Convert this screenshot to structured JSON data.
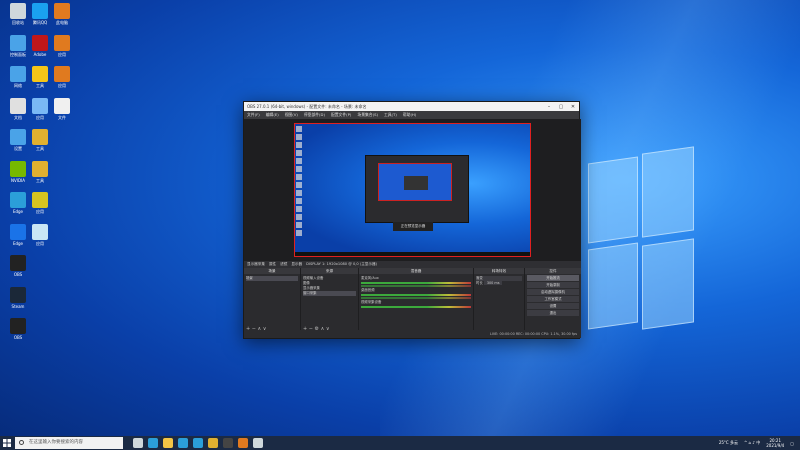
{
  "desktop_icons": [
    {
      "name": "icon-recycle",
      "label": "回收站",
      "color": "#cfd8dc"
    },
    {
      "name": "icon-qq",
      "label": "腾讯QQ",
      "color": "#1aa1f0"
    },
    {
      "name": "icon-app3",
      "label": "此电脑",
      "color": "#e07a1f"
    },
    {
      "name": "icon-app4",
      "label": "控制面板",
      "color": "#4aa3e8"
    },
    {
      "name": "icon-app5",
      "label": "Adobe",
      "color": "#c0171a"
    },
    {
      "name": "icon-app6",
      "label": "应用",
      "color": "#e07a1f"
    },
    {
      "name": "icon-app7",
      "label": "网络",
      "color": "#4aa3e8"
    },
    {
      "name": "icon-app8",
      "label": "工具",
      "color": "#f5c518"
    },
    {
      "name": "icon-app9",
      "label": "应用",
      "color": "#e07a1f"
    },
    {
      "name": "icon-app10",
      "label": "文档",
      "color": "#e0e0e0"
    },
    {
      "name": "icon-app11",
      "label": "应用",
      "color": "#7ab8f5"
    },
    {
      "name": "icon-app12",
      "label": "文件",
      "color": "#f0f0f0"
    },
    {
      "name": "icon-app13",
      "label": "设置",
      "color": "#4aa3e8"
    },
    {
      "name": "icon-app14",
      "label": "工具",
      "color": "#e0b030"
    },
    {
      "name": "icon-app15",
      "label": "NVIDIA",
      "color": "#76b900"
    },
    {
      "name": "icon-app16",
      "label": "工具",
      "color": "#e0b030"
    },
    {
      "name": "icon-app17",
      "label": "Edge",
      "color": "#2b9fd9"
    },
    {
      "name": "icon-app18",
      "label": "应用",
      "color": "#d6c420"
    },
    {
      "name": "icon-app19",
      "label": "Edge",
      "color": "#1a73e8"
    },
    {
      "name": "icon-app20",
      "label": "应用",
      "color": "#c9e6f5"
    },
    {
      "name": "icon-app21",
      "label": "OBS",
      "color": "#222"
    },
    {
      "name": "icon-app22",
      "label": "Steam",
      "color": "#1b2838"
    },
    {
      "name": "icon-app23",
      "label": "OBS",
      "color": "#222"
    }
  ],
  "obs": {
    "title": "OBS 27.0.1 (64-bit, windows) - 配置文件: 未命名 - 场景: 未命名",
    "menu": [
      "文件(F)",
      "编辑(E)",
      "视图(V)",
      "停靠部件(D)",
      "配置文件(P)",
      "场景集合(S)",
      "工具(T)",
      "帮助(H)"
    ],
    "scenebar": [
      "显示器采集",
      "属性",
      "滤镜",
      "显示器",
      "DISPLAY 1: 1920x1080 @ 0,0 (主显示器)"
    ],
    "tooltip": "正在预览显示器",
    "docks": {
      "scenes": {
        "title": "场景",
        "items": [
          "场景"
        ]
      },
      "sources": {
        "title": "来源",
        "items": [
          "视频输入设备",
          "图像",
          "显示器采集",
          "窗口采集"
        ]
      },
      "mixer": {
        "title": "混音器",
        "channels": [
          "麦克风/Aux",
          "桌面音频",
          "视频采集设备"
        ]
      },
      "transitions": {
        "title": "转场特效",
        "type": "渐变",
        "duration_label": "时长",
        "duration": "300 ms"
      },
      "controls": {
        "title": "控件",
        "buttons": [
          "开始推流",
          "开始录制",
          "启动虚拟摄像机",
          "工作室模式",
          "设置",
          "退出"
        ]
      }
    },
    "status": "LIVE: 00:00:00   REC: 00:00:00   CPU: 1.1%, 30.00 fps"
  },
  "taskbar": {
    "search_placeholder": "在这里输入你要搜索的内容",
    "weather": "25°C 多云",
    "time": "20:21",
    "date": "2021/9/4",
    "apps": [
      {
        "name": "taskview-icon",
        "color": "#cfd8dc"
      },
      {
        "name": "edge-taskbar-icon",
        "color": "#2b9fd9"
      },
      {
        "name": "explorer-taskbar-icon",
        "color": "#f3c545"
      },
      {
        "name": "store-taskbar-icon",
        "color": "#2b9fd9"
      },
      {
        "name": "mail-taskbar-icon",
        "color": "#2b9fd9"
      },
      {
        "name": "app-taskbar-icon",
        "color": "#e0b030"
      },
      {
        "name": "obs-taskbar-icon",
        "color": "#444"
      },
      {
        "name": "app2-taskbar-icon",
        "color": "#e07a1f"
      },
      {
        "name": "app3-taskbar-icon",
        "color": "#cfd8dc"
      }
    ]
  }
}
